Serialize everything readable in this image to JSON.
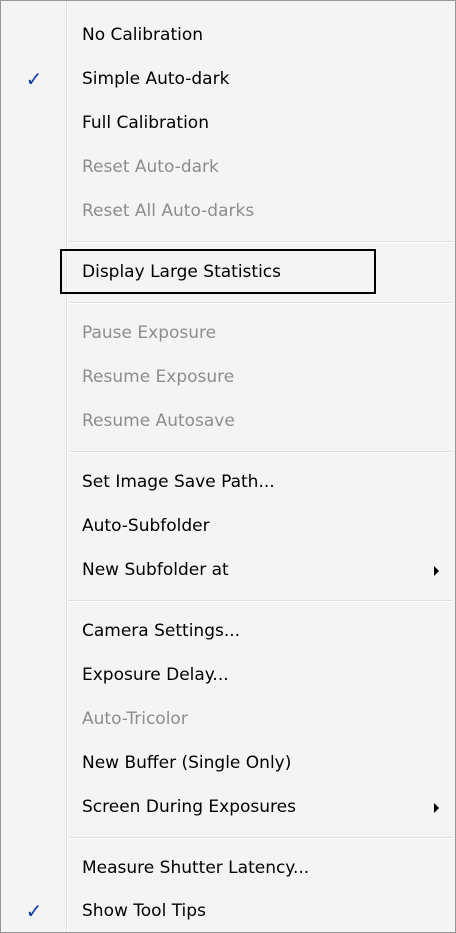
{
  "menu": {
    "items": [
      {
        "label": "No Calibration",
        "checked": false,
        "disabled": false,
        "submenu": false
      },
      {
        "label": "Simple Auto-dark",
        "checked": true,
        "disabled": false,
        "submenu": false
      },
      {
        "label": "Full Calibration",
        "checked": false,
        "disabled": false,
        "submenu": false
      },
      {
        "label": "Reset Auto-dark",
        "checked": false,
        "disabled": true,
        "submenu": false
      },
      {
        "label": "Reset All Auto-darks",
        "checked": false,
        "disabled": true,
        "submenu": false
      },
      {
        "label": "Display Large Statistics",
        "checked": false,
        "disabled": false,
        "submenu": false
      },
      {
        "label": "Pause Exposure",
        "checked": false,
        "disabled": true,
        "submenu": false
      },
      {
        "label": "Resume Exposure",
        "checked": false,
        "disabled": true,
        "submenu": false
      },
      {
        "label": "Resume Autosave",
        "checked": false,
        "disabled": true,
        "submenu": false
      },
      {
        "label": "Set Image Save Path...",
        "checked": false,
        "disabled": false,
        "submenu": false
      },
      {
        "label": "Auto-Subfolder",
        "checked": false,
        "disabled": false,
        "submenu": false
      },
      {
        "label": "New Subfolder at",
        "checked": false,
        "disabled": false,
        "submenu": true
      },
      {
        "label": "Camera Settings...",
        "checked": false,
        "disabled": false,
        "submenu": false
      },
      {
        "label": "Exposure Delay...",
        "checked": false,
        "disabled": false,
        "submenu": false
      },
      {
        "label": "Auto-Tricolor",
        "checked": false,
        "disabled": true,
        "submenu": false
      },
      {
        "label": "New Buffer (Single Only)",
        "checked": false,
        "disabled": false,
        "submenu": false
      },
      {
        "label": "Screen During Exposures",
        "checked": false,
        "disabled": false,
        "submenu": true
      },
      {
        "label": "Measure Shutter Latency...",
        "checked": false,
        "disabled": false,
        "submenu": false
      },
      {
        "label": "Show Tool Tips",
        "checked": true,
        "disabled": false,
        "submenu": false
      }
    ],
    "check_glyph": "✓",
    "highlighted_item": "Display Large Statistics"
  },
  "colors": {
    "menu_background": "#f4f4f4",
    "check_color": "#0b3aa8",
    "disabled_text": "#8d8d8d",
    "enabled_text": "#000000"
  },
  "icons": {
    "check": "checkmark-icon",
    "submenu": "submenu-arrow-icon"
  }
}
